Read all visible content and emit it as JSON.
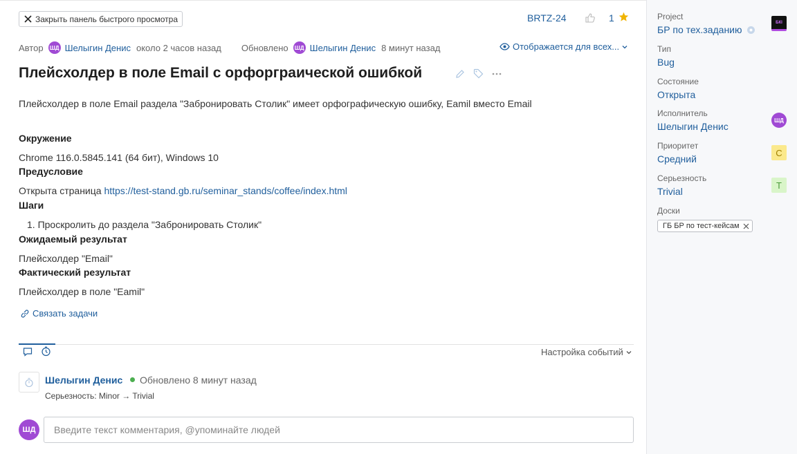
{
  "header": {
    "close_panel_label": "Закрыть панель быстрого просмотра",
    "issue_key": "BRTZ-24",
    "votes": "1"
  },
  "meta": {
    "author_label": "Автор",
    "author_initials": "ШД",
    "author_name": "Шелыгин Денис",
    "created_ago": "около 2 часов назад",
    "updated_label": "Обновлено",
    "updater_initials": "ШД",
    "updater_name": "Шелыгин Денис",
    "updated_ago": "8 минут назад",
    "visibility": "Отображается для всех..."
  },
  "issue": {
    "title": "Плейсхолдер в поле Email с орфорграической ошибкой",
    "description": "Плейсхолдер в поле Email раздела \"Забронировать Столик\" имеет орфографическую ошибку, Eamil вместо Email",
    "env_heading": "Окружение",
    "env_value": "Chrome 116.0.5845.141 (64 бит), Windows 10",
    "pre_heading": "Предусловие",
    "pre_text": "Открыта страница ",
    "pre_link": "https://test-stand.gb.ru/seminar_stands/coffee/index.html",
    "steps_heading": "Шаги",
    "steps": [
      "1. Проскролить до раздела \"Забронировать Столик\""
    ],
    "expected_heading": "Ожидаемый результат",
    "expected_value": "Плейсхолдер \"Email\"",
    "actual_heading": "Фактический результат",
    "actual_value": "Плейсхолдер в поле \"Eamil\"",
    "link_tasks": "Связать задачи"
  },
  "activity": {
    "settings_label": "Настройка событий",
    "history": {
      "user": "Шелыгин Денис",
      "time": "Обновлено 8 минут назад",
      "change": "Серьезность: Minor → Trivial"
    },
    "commenter_initials": "ШД",
    "comment_placeholder": "Введите текст комментария, @упоминайте людей"
  },
  "sidebar": {
    "project_label": "Project",
    "project_value": "БР по тех.заданию",
    "project_logo_text": "БКІ",
    "type_label": "Тип",
    "type_value": "Bug",
    "status_label": "Состояние",
    "status_value": "Открыта",
    "assignee_label": "Исполнитель",
    "assignee_value": "Шелыгин Денис",
    "assignee_initials": "ШД",
    "priority_label": "Приоритет",
    "priority_value": "Средний",
    "priority_badge": "С",
    "severity_label": "Серьезность",
    "severity_value": "Trivial",
    "severity_badge": "T",
    "boards_label": "Доски",
    "board_chip": "ГБ БР по тест-кейсам"
  },
  "colors": {
    "link": "#1f5e9c",
    "avatar": "#a04ad4",
    "star": "#f0b400",
    "priority_badge_bg": "#fbe98c",
    "severity_badge_bg": "#d9f5c9"
  }
}
